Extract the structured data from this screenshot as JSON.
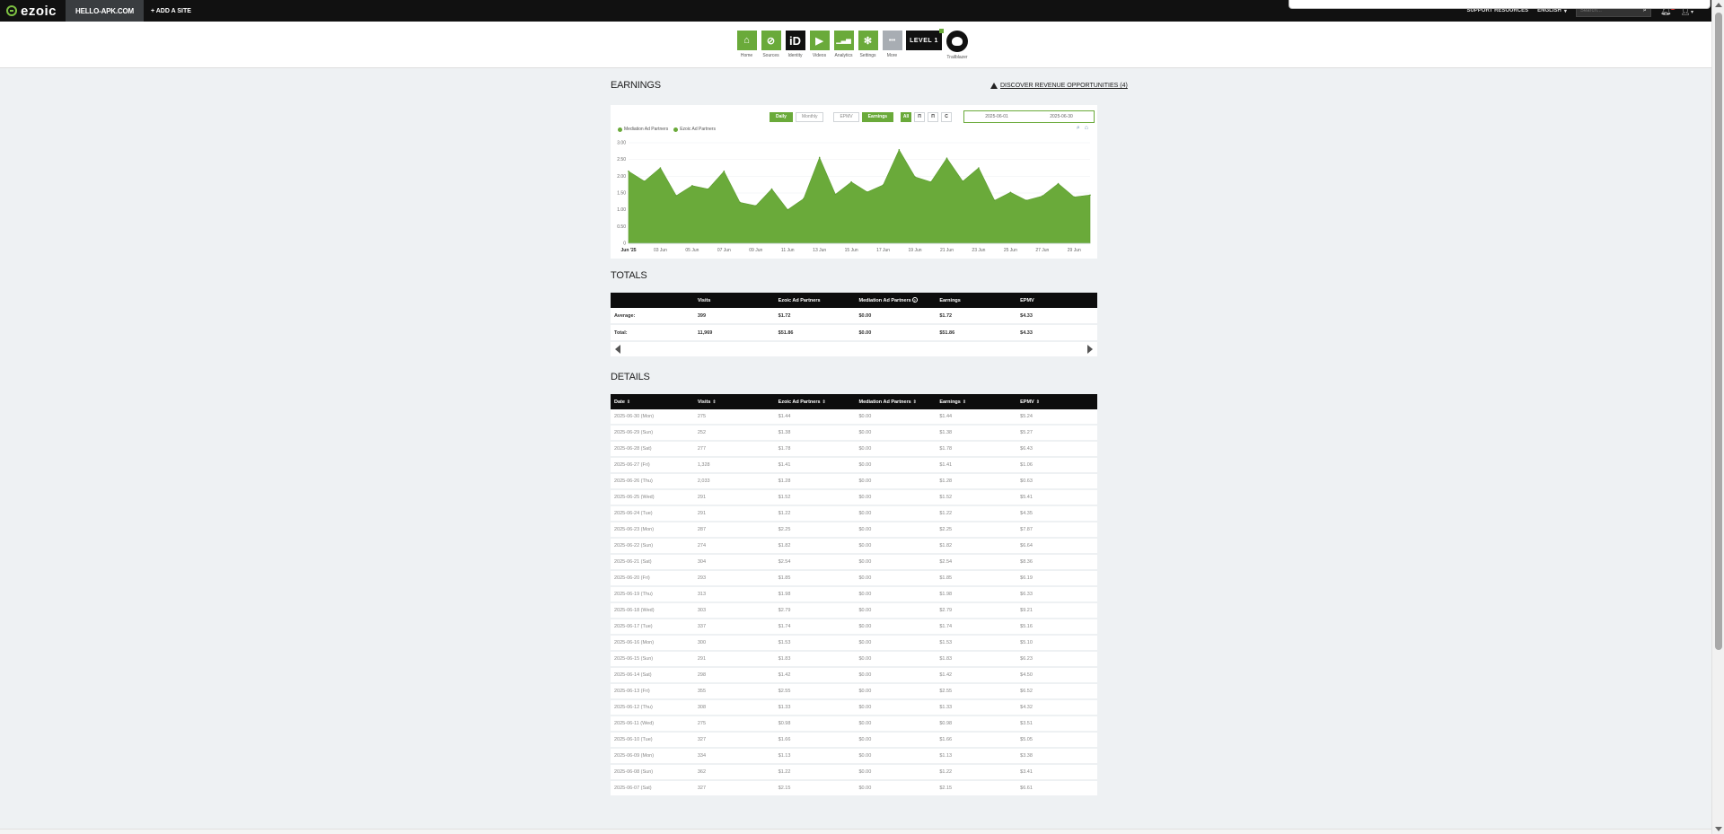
{
  "topbar": {
    "logo": "ezoic",
    "site": "HELLO-APK.COM",
    "add_site": "+ ADD A SITE",
    "support": "SUPPORT RESOURCES",
    "language": "ENGLISH",
    "search_placeholder": "Search...",
    "notifications": "9"
  },
  "nav": [
    {
      "label": "Home",
      "icon": "home-icon",
      "glyph": "⌂"
    },
    {
      "label": "Sources",
      "icon": "sources-icon",
      "glyph": "⊘"
    },
    {
      "label": "Identity",
      "icon": "identity-icon",
      "glyph": "iD"
    },
    {
      "label": "Videos",
      "icon": "video-icon",
      "glyph": "▶"
    },
    {
      "label": "Analytics",
      "icon": "analytics-icon",
      "glyph": "▁▃▅"
    },
    {
      "label": "Settings",
      "icon": "gear-icon",
      "glyph": "✻"
    },
    {
      "label": "More",
      "icon": "more-icon",
      "glyph": "•••"
    }
  ],
  "level_badge": "LEVEL 1",
  "trailblazer_label": "Trailblazer",
  "earnings": {
    "title": "EARNINGS",
    "discover": "DISCOVER REVENUE OPPORTUNITIES (4)",
    "controls": {
      "daily": "Daily",
      "monthly": "Monthly",
      "epmv": "EPMV",
      "earnings": "Earnings",
      "all": "All",
      "b1": "Π",
      "b2": "Π",
      "b3": "C"
    },
    "date_from": "2025-06-01",
    "date_to": "2025-06-30",
    "legend": [
      "Mediation Ad Partners",
      "Ezoic Ad Partners"
    ]
  },
  "chart_data": {
    "type": "area",
    "series": [
      {
        "name": "Mediation Ad Partners",
        "values": [
          0,
          0,
          0,
          0,
          0,
          0,
          0,
          0,
          0,
          0,
          0,
          0,
          0,
          0,
          0,
          0,
          0,
          0,
          0,
          0,
          0,
          0,
          0,
          0,
          0,
          0,
          0,
          0,
          0,
          0
        ]
      },
      {
        "name": "Ezoic Ad Partners",
        "values": [
          2.15,
          1.85,
          2.25,
          1.42,
          1.72,
          1.62,
          2.15,
          1.22,
          1.12,
          1.62,
          1.0,
          1.33,
          2.56,
          1.46,
          1.83,
          1.53,
          1.74,
          2.79,
          1.98,
          1.83,
          2.54,
          1.85,
          2.25,
          1.28,
          1.52,
          1.28,
          1.41,
          1.78,
          1.38,
          1.44
        ]
      }
    ],
    "x_labels": [
      "Jun '25",
      "03 Jun",
      "05 Jun",
      "07 Jun",
      "09 Jun",
      "11 Jun",
      "13 Jun",
      "15 Jun",
      "17 Jun",
      "19 Jun",
      "21 Jun",
      "23 Jun",
      "25 Jun",
      "27 Jun",
      "29 Jun"
    ],
    "y_ticks": [
      "0",
      "0.50",
      "1.00",
      "1.50",
      "2.00",
      "2.50",
      "3.00"
    ],
    "ylim": [
      0,
      3
    ],
    "color": "#6aaa3a"
  },
  "totals": {
    "title": "TOTALS",
    "headers": [
      "",
      "Visits",
      "Ezoic Ad Partners",
      "Mediation Ad Partners",
      "Earnings",
      "EPMV"
    ],
    "rows": [
      [
        "Average:",
        "399",
        "$1.72",
        "$0.00",
        "$1.72",
        "$4.33"
      ],
      [
        "Total:",
        "11,969",
        "$51.86",
        "$0.00",
        "$51.86",
        "$4.33"
      ]
    ]
  },
  "details": {
    "title": "DETAILS",
    "headers": [
      "Date",
      "Visits",
      "Ezoic Ad Partners",
      "Mediation Ad Partners",
      "Earnings",
      "EPMV"
    ],
    "rows": [
      [
        "2025-06-30 (Mon)",
        "275",
        "$1.44",
        "$0.00",
        "$1.44",
        "$5.24"
      ],
      [
        "2025-06-29 (Sun)",
        "252",
        "$1.38",
        "$0.00",
        "$1.38",
        "$5.27"
      ],
      [
        "2025-06-28 (Sat)",
        "277",
        "$1.78",
        "$0.00",
        "$1.78",
        "$6.43"
      ],
      [
        "2025-06-27 (Fri)",
        "1,328",
        "$1.41",
        "$0.00",
        "$1.41",
        "$1.06"
      ],
      [
        "2025-06-26 (Thu)",
        "2,033",
        "$1.28",
        "$0.00",
        "$1.28",
        "$0.63"
      ],
      [
        "2025-06-25 (Wed)",
        "291",
        "$1.52",
        "$0.00",
        "$1.52",
        "$5.41"
      ],
      [
        "2025-06-24 (Tue)",
        "291",
        "$1.22",
        "$0.00",
        "$1.22",
        "$4.35"
      ],
      [
        "2025-06-23 (Mon)",
        "287",
        "$2.25",
        "$0.00",
        "$2.25",
        "$7.87"
      ],
      [
        "2025-06-22 (Sun)",
        "274",
        "$1.82",
        "$0.00",
        "$1.82",
        "$6.64"
      ],
      [
        "2025-06-21 (Sat)",
        "304",
        "$2.54",
        "$0.00",
        "$2.54",
        "$8.36"
      ],
      [
        "2025-06-20 (Fri)",
        "293",
        "$1.85",
        "$0.00",
        "$1.85",
        "$6.19"
      ],
      [
        "2025-06-19 (Thu)",
        "313",
        "$1.98",
        "$0.00",
        "$1.98",
        "$6.33"
      ],
      [
        "2025-06-18 (Wed)",
        "303",
        "$2.79",
        "$0.00",
        "$2.79",
        "$9.21"
      ],
      [
        "2025-06-17 (Tue)",
        "337",
        "$1.74",
        "$0.00",
        "$1.74",
        "$5.16"
      ],
      [
        "2025-06-16 (Mon)",
        "300",
        "$1.53",
        "$0.00",
        "$1.53",
        "$5.10"
      ],
      [
        "2025-06-15 (Sun)",
        "291",
        "$1.83",
        "$0.00",
        "$1.83",
        "$6.23"
      ],
      [
        "2025-06-14 (Sat)",
        "298",
        "$1.42",
        "$0.00",
        "$1.42",
        "$4.50"
      ],
      [
        "2025-06-13 (Fri)",
        "355",
        "$2.55",
        "$0.00",
        "$2.55",
        "$6.52"
      ],
      [
        "2025-06-12 (Thu)",
        "308",
        "$1.33",
        "$0.00",
        "$1.33",
        "$4.32"
      ],
      [
        "2025-06-11 (Wed)",
        "275",
        "$0.98",
        "$0.00",
        "$0.98",
        "$3.51"
      ],
      [
        "2025-06-10 (Tue)",
        "327",
        "$1.66",
        "$0.00",
        "$1.66",
        "$5.05"
      ],
      [
        "2025-06-09 (Mon)",
        "334",
        "$1.13",
        "$0.00",
        "$1.13",
        "$3.38"
      ],
      [
        "2025-06-08 (Sun)",
        "362",
        "$1.22",
        "$0.00",
        "$1.22",
        "$3.41"
      ],
      [
        "2025-06-07 (Sat)",
        "327",
        "$2.15",
        "$0.00",
        "$2.15",
        "$6.61"
      ]
    ]
  }
}
